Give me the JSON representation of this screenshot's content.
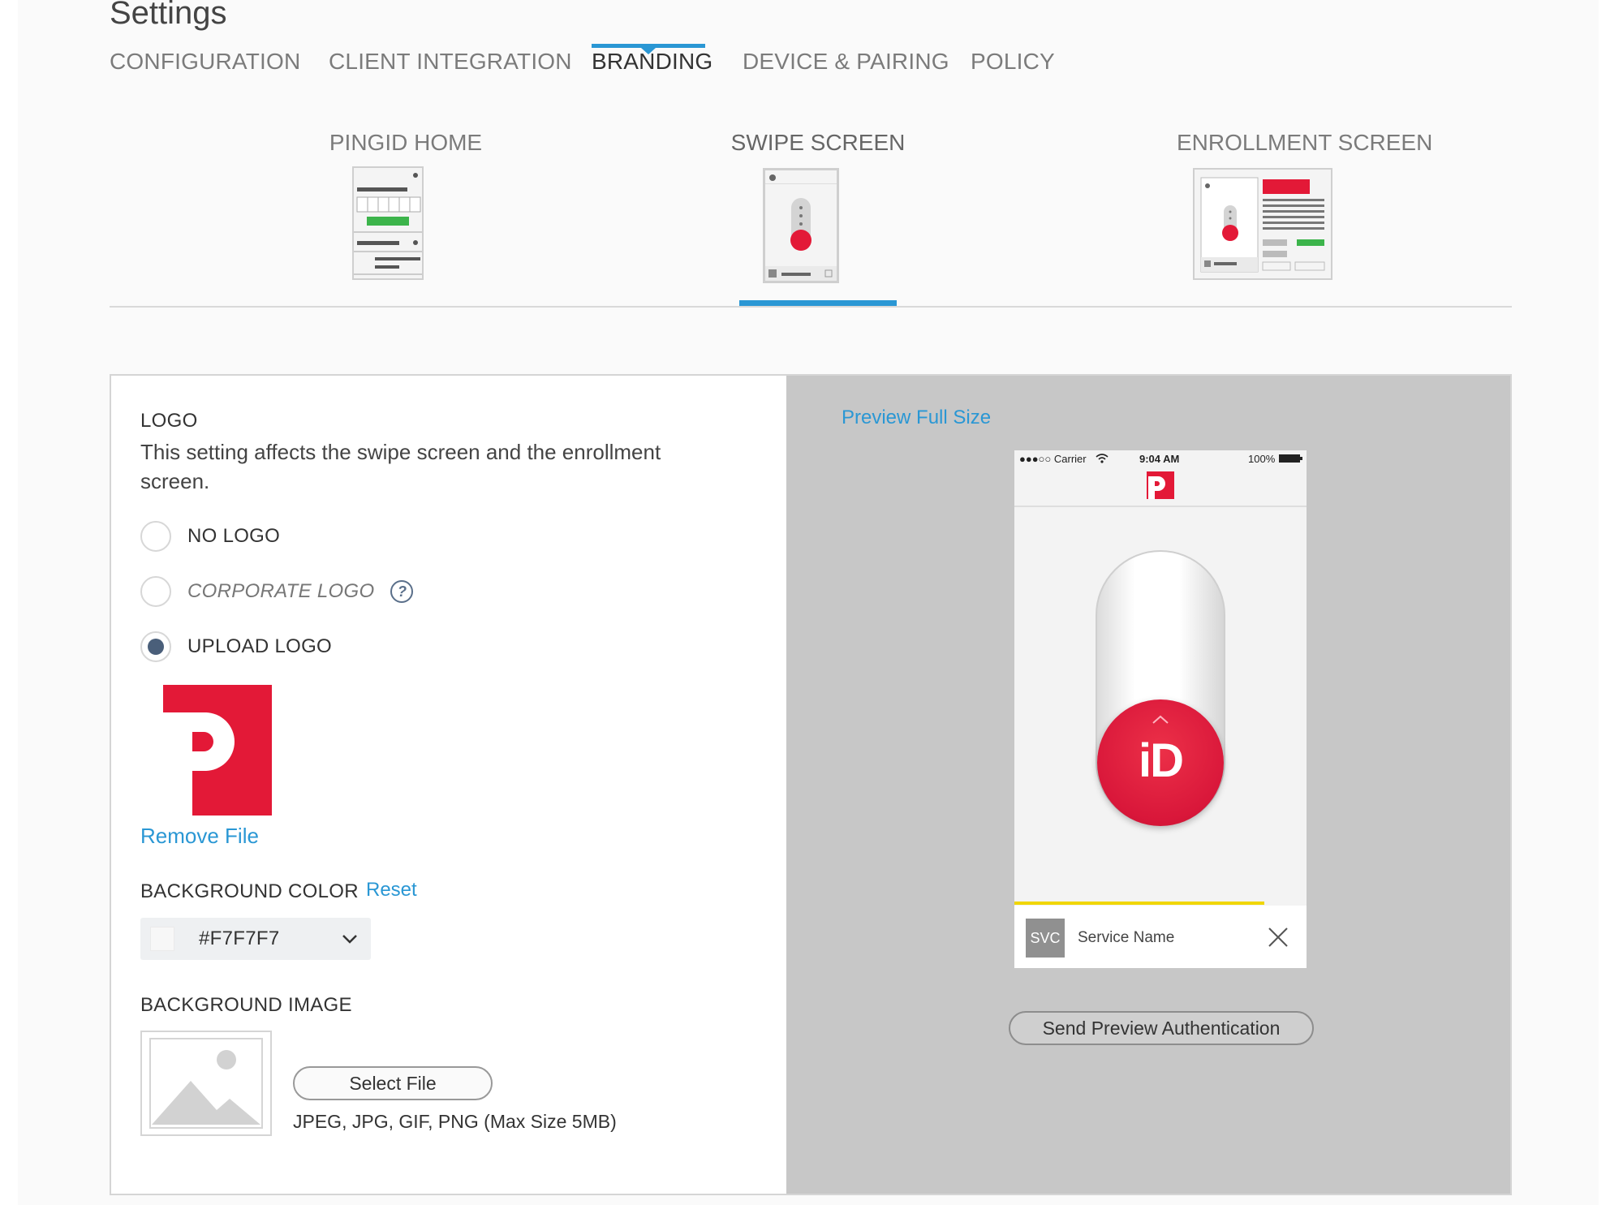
{
  "page": {
    "title": "Settings"
  },
  "tabs": [
    "CONFIGURATION",
    "CLIENT INTEGRATION",
    "BRANDING",
    "DEVICE & PAIRING",
    "POLICY"
  ],
  "active_tab": "BRANDING",
  "subtabs": [
    "PINGID HOME",
    "SWIPE SCREEN",
    "ENROLLMENT SCREEN"
  ],
  "active_subtab": "SWIPE SCREEN",
  "logo": {
    "heading": "LOGO",
    "description": "This setting affects the swipe screen and the enrollment screen.",
    "options": [
      "NO LOGO",
      "CORPORATE LOGO",
      "UPLOAD LOGO"
    ],
    "selected": "UPLOAD LOGO",
    "help_icon_glyph": "?",
    "remove_label": "Remove File"
  },
  "background_color": {
    "heading": "BACKGROUND COLOR",
    "reset_label": "Reset",
    "value": "#F7F7F7"
  },
  "background_image": {
    "heading": "BACKGROUND IMAGE",
    "select_label": "Select File",
    "hint": "JPEG, JPG, GIF, PNG (Max Size 5MB)"
  },
  "preview": {
    "full_size_label": "Preview Full Size",
    "status": {
      "signal": "●●●○○ Carrier",
      "time": "9:04 AM",
      "battery": "100%"
    },
    "swipe_text": "iD",
    "service_badge": "SVC",
    "service_name": "Service Name",
    "send_label": "Send Preview Authentication"
  },
  "colors": {
    "accent": "#2a97d4",
    "brand_red": "#e31937",
    "radio_checked": "#4a5f7a",
    "preview_bg": "#c7c7c7",
    "progress_yellow": "#f0d600"
  }
}
